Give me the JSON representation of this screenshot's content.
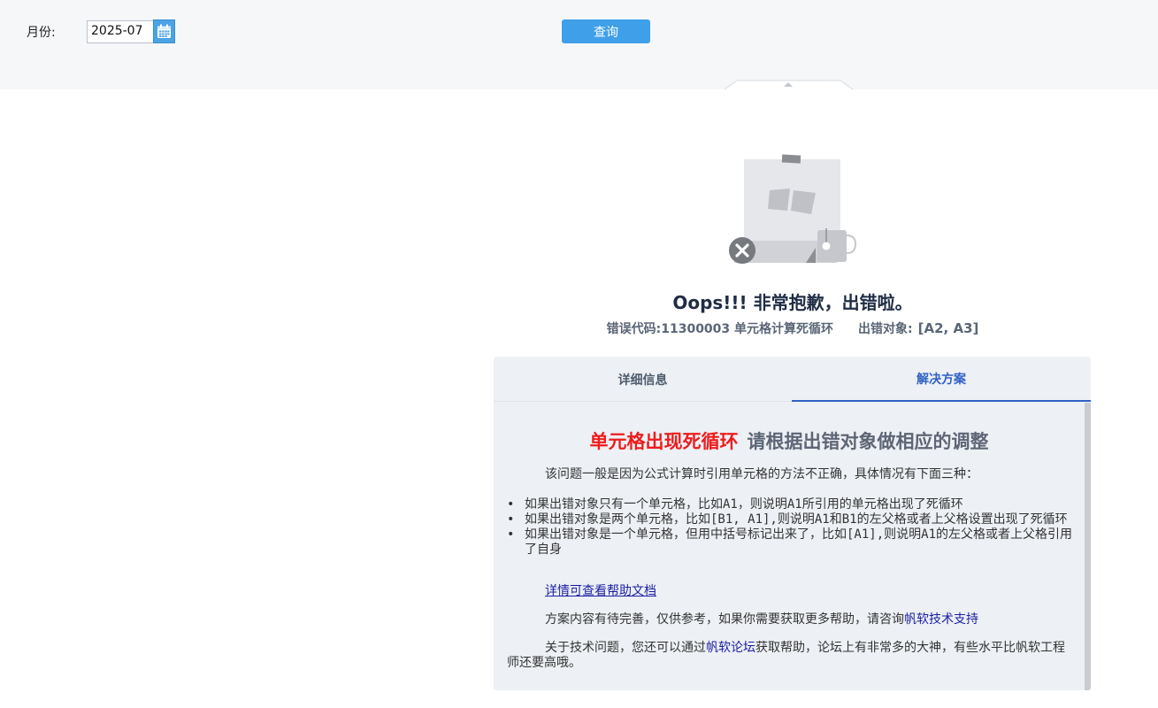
{
  "params": {
    "month_label": "月份:",
    "month_value": "2025-07",
    "query_label": "查询"
  },
  "error": {
    "title": "Oops!!! 非常抱歉，出错啦。",
    "code_text": "错误代码:11300003 单元格计算死循环",
    "target_label": "出错对象:",
    "target_value": "[A2, A3]"
  },
  "tabs": {
    "detail": "详细信息",
    "solution": "解决方案",
    "active": "solution"
  },
  "solution": {
    "head_red": "单元格出现死循环",
    "head_gray": "请根据出错对象做相应的调整",
    "intro": "该问题一般是因为公式计算时引用单元格的方法不正确，具体情况有下面三种：",
    "bullets": [
      "如果出错对象只有一个单元格，比如A1，则说明A1所引用的单元格出现了死循环",
      "如果出错对象是两个单元格，比如[B1, A1],则说明A1和B1的左父格或者上父格设置出现了死循环",
      "如果出错对象是一个单元格，但用中括号标记出来了，比如[A1],则说明A1的左父格或者上父格引用了自身"
    ],
    "help_link": "详情可查看帮助文档",
    "support_text": "方案内容有待完善，仅供参考，如果你需要获取更多帮助，请咨询",
    "support_link": "帆软技术支持",
    "forum_prefix": "关于技术问题，您还可以通过",
    "forum_link": "帆软论坛",
    "forum_suffix": "获取帮助，论坛上有非常多的大神，有些水平比帆软工程师还要高哦。"
  },
  "colors": {
    "accent": "#3f9fe8",
    "active_tab": "#2f61c4",
    "headline_red": "#ee1c1c",
    "link": "#1b1fa3"
  },
  "icons": [
    "calendar-icon",
    "error-illustration",
    "close-icon"
  ]
}
